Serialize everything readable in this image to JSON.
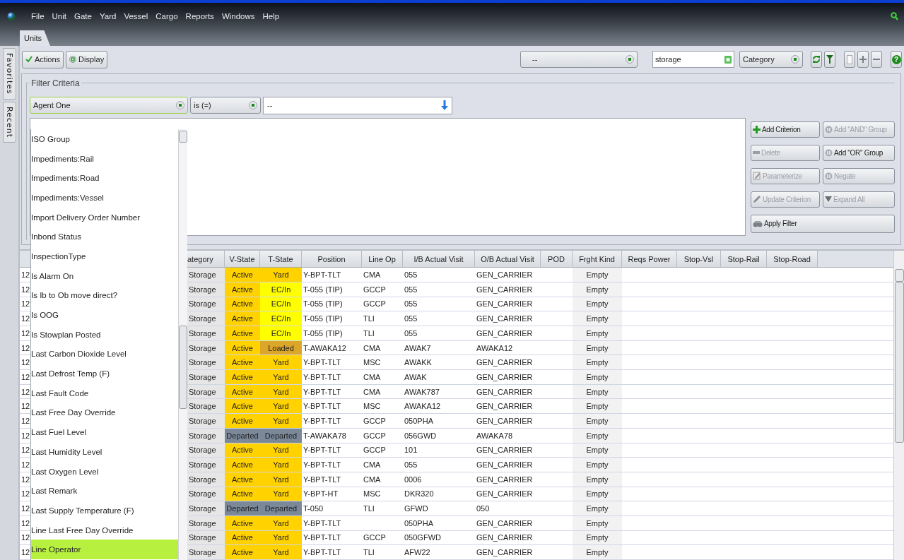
{
  "menu": [
    "File",
    "Unit",
    "Gate",
    "Yard",
    "Vessel",
    "Cargo",
    "Reports",
    "Windows",
    "Help"
  ],
  "tabs": [
    {
      "label": "Units",
      "selected": true
    }
  ],
  "side_tabs": [
    "Favorites",
    "Recent"
  ],
  "toolbar": {
    "actions": "Actions",
    "display": "Display",
    "combo": "--",
    "search_value": "storage",
    "group_by": "Category",
    "help": "?"
  },
  "filter": {
    "legend": "Filter Criteria",
    "field": "Agent One",
    "operator": "is (=)",
    "value": "--",
    "buttons": [
      {
        "label": "Add Criterion",
        "disabled": false
      },
      {
        "label": "Add \"AND\" Group",
        "disabled": true
      },
      {
        "label": "Delete",
        "disabled": true
      },
      {
        "label": "Add \"OR\" Group",
        "disabled": false
      },
      {
        "label": "Parameterize",
        "disabled": true
      },
      {
        "label": "Negate",
        "disabled": true
      },
      {
        "label": "Update Criterion",
        "disabled": true
      },
      {
        "label": "Expand All",
        "disabled": true
      },
      {
        "label": "Apply Filter",
        "disabled": false
      }
    ]
  },
  "field_list": {
    "items": [
      {
        "label": "ISO Group",
        "selected": false
      },
      {
        "label": "Impediments:Rail",
        "selected": false
      },
      {
        "label": "Impediments:Road",
        "selected": false
      },
      {
        "label": "Impediments:Vessel",
        "selected": false
      },
      {
        "label": "Import Delivery Order Number",
        "selected": false
      },
      {
        "label": "Inbond Status",
        "selected": false
      },
      {
        "label": "InspectionType",
        "selected": false
      },
      {
        "label": "Is Alarm On",
        "selected": false
      },
      {
        "label": "Is Ib to Ob move direct?",
        "selected": false
      },
      {
        "label": "Is OOG",
        "selected": false
      },
      {
        "label": "Is Stowplan Posted",
        "selected": false
      },
      {
        "label": "Last Carbon Dioxide Level",
        "selected": false
      },
      {
        "label": "Last Defrost Temp (F)",
        "selected": false
      },
      {
        "label": "Last Fault Code",
        "selected": false
      },
      {
        "label": "Last Free Day Override",
        "selected": false
      },
      {
        "label": "Last Fuel Level",
        "selected": false
      },
      {
        "label": "Last Humidity Level",
        "selected": false
      },
      {
        "label": "Last Oxygen Level",
        "selected": false
      },
      {
        "label": "Last Remark",
        "selected": false
      },
      {
        "label": "Last Supply Temperature (F)",
        "selected": false
      },
      {
        "label": "Line Last Free Day Override",
        "selected": false
      },
      {
        "label": "Line Operator",
        "selected": true
      }
    ]
  },
  "table": {
    "columns": [
      "ategory",
      "V-State",
      "T-State",
      "Position",
      "Line Op",
      "I/B Actual Visit",
      "O/B Actual Visit",
      "POD",
      "Frght Kind",
      "Reqs Power",
      "Stop-Vsl",
      "Stop-Rail",
      "Stop-Road"
    ],
    "rows": [
      {
        "column_1": "12",
        "category": "Storage",
        "v_state": {
          "text": "Active",
          "color": "#ffd200"
        },
        "t_state": {
          "text": "Yard",
          "color": "#ffd200"
        },
        "position": "Y-BPT-TLT",
        "line_op": "CMA",
        "ib_actual_visit": "055",
        "ob_actual_visit": "GEN_CARRIER",
        "frght_kind": "Empty"
      },
      {
        "column_1": "12",
        "category": "Storage",
        "v_state": {
          "text": "Active",
          "color": "#ffd200"
        },
        "t_state": {
          "text": "EC/In",
          "color": "#ffff00"
        },
        "position": "T-055 (TIP)",
        "line_op": "GCCP",
        "ib_actual_visit": "055",
        "ob_actual_visit": "GEN_CARRIER",
        "frght_kind": "Empty"
      },
      {
        "column_1": "12",
        "category": "Storage",
        "v_state": {
          "text": "Active",
          "color": "#ffd200"
        },
        "t_state": {
          "text": "EC/In",
          "color": "#ffff00"
        },
        "position": "T-055 (TIP)",
        "line_op": "GCCP",
        "ib_actual_visit": "055",
        "ob_actual_visit": "GEN_CARRIER",
        "frght_kind": "Empty"
      },
      {
        "column_1": "12",
        "category": "Storage",
        "v_state": {
          "text": "Active",
          "color": "#ffd200"
        },
        "t_state": {
          "text": "EC/In",
          "color": "#ffff00"
        },
        "position": "T-055 (TIP)",
        "line_op": "TLI",
        "ib_actual_visit": "055",
        "ob_actual_visit": "GEN_CARRIER",
        "frght_kind": "Empty"
      },
      {
        "column_1": "12",
        "category": "Storage",
        "v_state": {
          "text": "Active",
          "color": "#ffd200"
        },
        "t_state": {
          "text": "EC/In",
          "color": "#ffff00"
        },
        "position": "T-055 (TIP)",
        "line_op": "TLI",
        "ib_actual_visit": "055",
        "ob_actual_visit": "GEN_CARRIER",
        "frght_kind": "Empty"
      },
      {
        "column_1": "12",
        "category": "Storage",
        "v_state": {
          "text": "Active",
          "color": "#ffd200"
        },
        "t_state": {
          "text": "Loaded",
          "color": "#dca628"
        },
        "position": "T-AWAKA12",
        "line_op": "CMA",
        "ib_actual_visit": "AWAK7",
        "ob_actual_visit": "AWAKA12",
        "frght_kind": "Empty"
      },
      {
        "column_1": "12",
        "category": "Storage",
        "v_state": {
          "text": "Active",
          "color": "#ffd200"
        },
        "t_state": {
          "text": "Yard",
          "color": "#ffd200"
        },
        "position": "Y-BPT-TLT",
        "line_op": "MSC",
        "ib_actual_visit": "AWAKK",
        "ob_actual_visit": "GEN_CARRIER",
        "frght_kind": "Empty"
      },
      {
        "column_1": "12",
        "category": "Storage",
        "v_state": {
          "text": "Active",
          "color": "#ffd200"
        },
        "t_state": {
          "text": "Yard",
          "color": "#ffd200"
        },
        "position": "Y-BPT-TLT",
        "line_op": "CMA",
        "ib_actual_visit": "AWAK",
        "ob_actual_visit": "GEN_CARRIER",
        "frght_kind": "Empty"
      },
      {
        "column_1": "12",
        "category": "Storage",
        "v_state": {
          "text": "Active",
          "color": "#ffd200"
        },
        "t_state": {
          "text": "Yard",
          "color": "#ffd200"
        },
        "position": "Y-BPT-TLT",
        "line_op": "CMA",
        "ib_actual_visit": "AWAK787",
        "ob_actual_visit": "GEN_CARRIER",
        "frght_kind": "Empty"
      },
      {
        "column_1": "12",
        "category": "Storage",
        "v_state": {
          "text": "Active",
          "color": "#ffd200"
        },
        "t_state": {
          "text": "Yard",
          "color": "#ffd200"
        },
        "position": "Y-BPT-TLT",
        "line_op": "MSC",
        "ib_actual_visit": "AWAKA12",
        "ob_actual_visit": "GEN_CARRIER",
        "frght_kind": "Empty"
      },
      {
        "column_1": "12",
        "category": "Storage",
        "v_state": {
          "text": "Active",
          "color": "#ffd200"
        },
        "t_state": {
          "text": "Yard",
          "color": "#ffd200"
        },
        "position": "Y-BPT-TLT",
        "line_op": "GCCP",
        "ib_actual_visit": "050PHA",
        "ob_actual_visit": "GEN_CARRIER",
        "frght_kind": "Empty"
      },
      {
        "column_1": "12",
        "category": "Storage",
        "v_state": {
          "text": "Departed",
          "color": "#7a8898"
        },
        "t_state": {
          "text": "Departed",
          "color": "#7a8898"
        },
        "position": "T-AWAKA78",
        "line_op": "GCCP",
        "ib_actual_visit": "056GWD",
        "ob_actual_visit": "AWAKA78",
        "frght_kind": "Empty"
      },
      {
        "column_1": "12",
        "category": "Storage",
        "v_state": {
          "text": "Active",
          "color": "#ffd200"
        },
        "t_state": {
          "text": "Yard",
          "color": "#ffd200"
        },
        "position": "Y-BPT-TLT",
        "line_op": "GCCP",
        "ib_actual_visit": "101",
        "ob_actual_visit": "GEN_CARRIER",
        "frght_kind": "Empty"
      },
      {
        "column_1": "12",
        "category": "Storage",
        "v_state": {
          "text": "Active",
          "color": "#ffd200"
        },
        "t_state": {
          "text": "Yard",
          "color": "#ffd200"
        },
        "position": "Y-BPT-TLT",
        "line_op": "CMA",
        "ib_actual_visit": "055",
        "ob_actual_visit": "GEN_CARRIER",
        "frght_kind": "Empty"
      },
      {
        "column_1": "12",
        "category": "Storage",
        "v_state": {
          "text": "Active",
          "color": "#ffd200"
        },
        "t_state": {
          "text": "Yard",
          "color": "#ffd200"
        },
        "position": "Y-BPT-TLT",
        "line_op": "CMA",
        "ib_actual_visit": "0006",
        "ob_actual_visit": "GEN_CARRIER",
        "frght_kind": "Empty"
      },
      {
        "column_1": "12",
        "category": "Storage",
        "v_state": {
          "text": "Active",
          "color": "#ffd200"
        },
        "t_state": {
          "text": "Yard",
          "color": "#ffd200"
        },
        "position": "Y-BPT-HT",
        "line_op": "MSC",
        "ib_actual_visit": "DKR320",
        "ob_actual_visit": "GEN_CARRIER",
        "frght_kind": "Empty"
      },
      {
        "column_1": "12",
        "category": "Storage",
        "v_state": {
          "text": "Departed",
          "color": "#7a8898"
        },
        "t_state": {
          "text": "Departed",
          "color": "#7a8898"
        },
        "position": "T-050",
        "line_op": "TLI",
        "ib_actual_visit": "GFWD",
        "ob_actual_visit": "050",
        "frght_kind": "Empty"
      },
      {
        "column_1": "12",
        "category": "Storage",
        "v_state": {
          "text": "Active",
          "color": "#ffd200"
        },
        "t_state": {
          "text": "Yard",
          "color": "#ffd200"
        },
        "position": "Y-BPT-TLT",
        "ib_actual_visit": "050PHA",
        "ob_actual_visit": "GEN_CARRIER",
        "frght_kind": "Empty"
      },
      {
        "column_1": "12",
        "category": "Storage",
        "v_state": {
          "text": "Active",
          "color": "#ffd200"
        },
        "t_state": {
          "text": "Yard",
          "color": "#ffd200"
        },
        "position": "Y-BPT-TLT",
        "line_op": "GCCP",
        "ib_actual_visit": "050GFWD",
        "ob_actual_visit": "GEN_CARRIER",
        "frght_kind": "Empty"
      },
      {
        "column_1": "12",
        "category": "Storage",
        "v_state": {
          "text": "Active",
          "color": "#ffd200"
        },
        "t_state": {
          "text": "Yard",
          "color": "#ffd200"
        },
        "position": "Y-BPT-TLT",
        "line_op": "TLI",
        "ib_actual_visit": "AFW22",
        "ob_actual_visit": "GEN_CARRIER",
        "frght_kind": "Empty"
      }
    ]
  }
}
